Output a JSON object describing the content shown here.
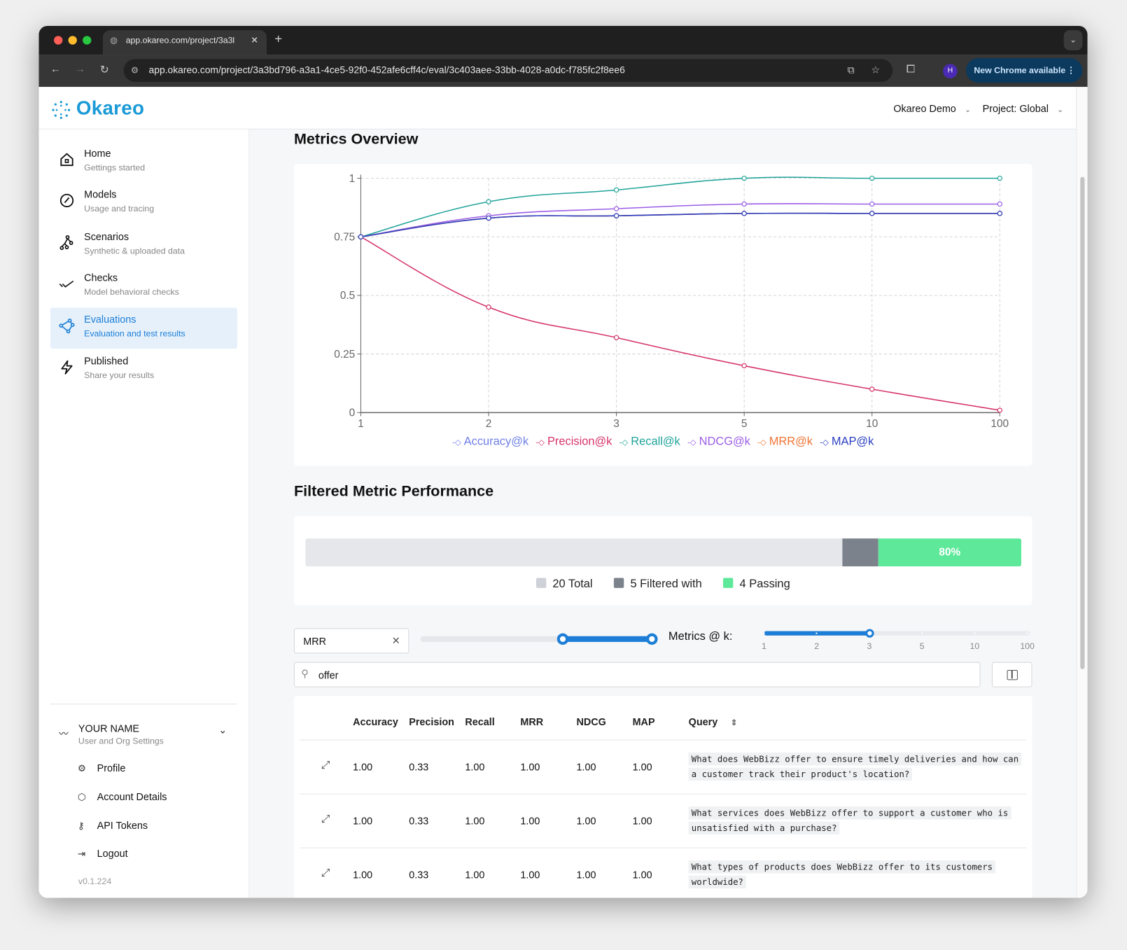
{
  "browser": {
    "tab_title": "app.okareo.com/project/3a3l",
    "url": "app.okareo.com/project/3a3bd796-a3a1-4ce5-92f0-452afe6cff4c/eval/3c403aee-33bb-4028-a0dc-f785fc2f8ee6",
    "profile_initial": "H",
    "new_chrome_label": "New Chrome available"
  },
  "header": {
    "logo": "Okareo",
    "org": "Okareo Demo",
    "project": "Project: Global"
  },
  "sidebar": {
    "items": [
      {
        "label": "Home",
        "sub": "Gettings started",
        "icon": "home-icon"
      },
      {
        "label": "Models",
        "sub": "Usage and tracing",
        "icon": "gauge-icon"
      },
      {
        "label": "Scenarios",
        "sub": "Synthetic & uploaded data",
        "icon": "graph-nodes-icon"
      },
      {
        "label": "Checks",
        "sub": "Model behavioral checks",
        "icon": "double-check-icon"
      },
      {
        "label": "Evaluations",
        "sub": "Evaluation and test results",
        "icon": "polygon-icon",
        "active": true
      },
      {
        "label": "Published",
        "sub": "Share your results",
        "icon": "bolt-icon"
      }
    ],
    "user": {
      "name": "YOUR NAME",
      "sub": "User and Org Settings"
    },
    "user_menu": [
      {
        "label": "Profile",
        "icon": "gear-icon"
      },
      {
        "label": "Account Details",
        "icon": "cube-icon"
      },
      {
        "label": "API Tokens",
        "icon": "key-icon"
      },
      {
        "label": "Logout",
        "icon": "logout-icon"
      }
    ],
    "version": "v0.1.224"
  },
  "metrics_overview": {
    "title": "Metrics Overview"
  },
  "chart_data": {
    "type": "line",
    "categories": [
      "1",
      "2",
      "3",
      "5",
      "10",
      "100"
    ],
    "yticks": [
      "0",
      "0.25",
      "0.5",
      "0.75",
      "1"
    ],
    "ylim": [
      0,
      1
    ],
    "grid": true,
    "legend_position": "bottom",
    "series": [
      {
        "name": "Accuracy@k",
        "color": "#6f7fe6",
        "values": [
          0.75,
          0.83,
          0.84,
          0.85,
          0.85,
          0.85
        ]
      },
      {
        "name": "Precision@k",
        "color": "#d6336c",
        "values": [
          0.75,
          0.45,
          0.32,
          0.2,
          0.1,
          0.01
        ]
      },
      {
        "name": "Recall@k",
        "color": "#20a39a",
        "values": [
          0.75,
          0.9,
          0.95,
          1,
          1,
          1
        ]
      },
      {
        "name": "NDCG@k",
        "color": "#9b5de5",
        "values": [
          0.75,
          0.84,
          0.87,
          0.89,
          0.89,
          0.89
        ]
      },
      {
        "name": "MRR@k",
        "color": "#f07434",
        "values": [
          0.75,
          0.83,
          0.84,
          0.85,
          0.85,
          0.85
        ]
      },
      {
        "name": "MAP@k",
        "color": "#2b3fc0",
        "values": [
          0.75,
          0.83,
          0.84,
          0.85,
          0.85,
          0.85
        ]
      }
    ]
  },
  "filtered": {
    "title": "Filtered Metric Performance",
    "total": 20,
    "filtered": 5,
    "passing": 4,
    "pass_pct_label": "80%",
    "legend": {
      "total": "20 Total",
      "filtered": "5 Filtered with",
      "passing": "4 Passing"
    },
    "colors": {
      "total": "#e5e7eb",
      "filtered": "#7c828b",
      "passing": "#5ee89a"
    }
  },
  "controls": {
    "metric_filter": "MRR",
    "range_value": [
      0.6,
      1.0
    ],
    "k_label": "Metrics @ k:",
    "k_ticks": [
      "1",
      "2",
      "3",
      "5",
      "10",
      "100"
    ],
    "k_selected": "3",
    "search_value": "offer"
  },
  "table": {
    "columns": [
      "Accuracy",
      "Precision",
      "Recall",
      "MRR",
      "NDCG",
      "MAP",
      "Query"
    ],
    "rows": [
      {
        "accuracy": "1.00",
        "precision": "0.33",
        "recall": "1.00",
        "mrr": "1.00",
        "ndcg": "1.00",
        "map": "1.00",
        "query": "What does WebBizz offer to ensure timely deliveries and how can a customer track their product's location?"
      },
      {
        "accuracy": "1.00",
        "precision": "0.33",
        "recall": "1.00",
        "mrr": "1.00",
        "ndcg": "1.00",
        "map": "1.00",
        "query": "What services does WebBizz offer to support a customer who is unsatisfied with a purchase?"
      },
      {
        "accuracy": "1.00",
        "precision": "0.33",
        "recall": "1.00",
        "mrr": "1.00",
        "ndcg": "1.00",
        "map": "1.00",
        "query": "What types of products does WebBizz offer to its customers worldwide?"
      }
    ]
  }
}
